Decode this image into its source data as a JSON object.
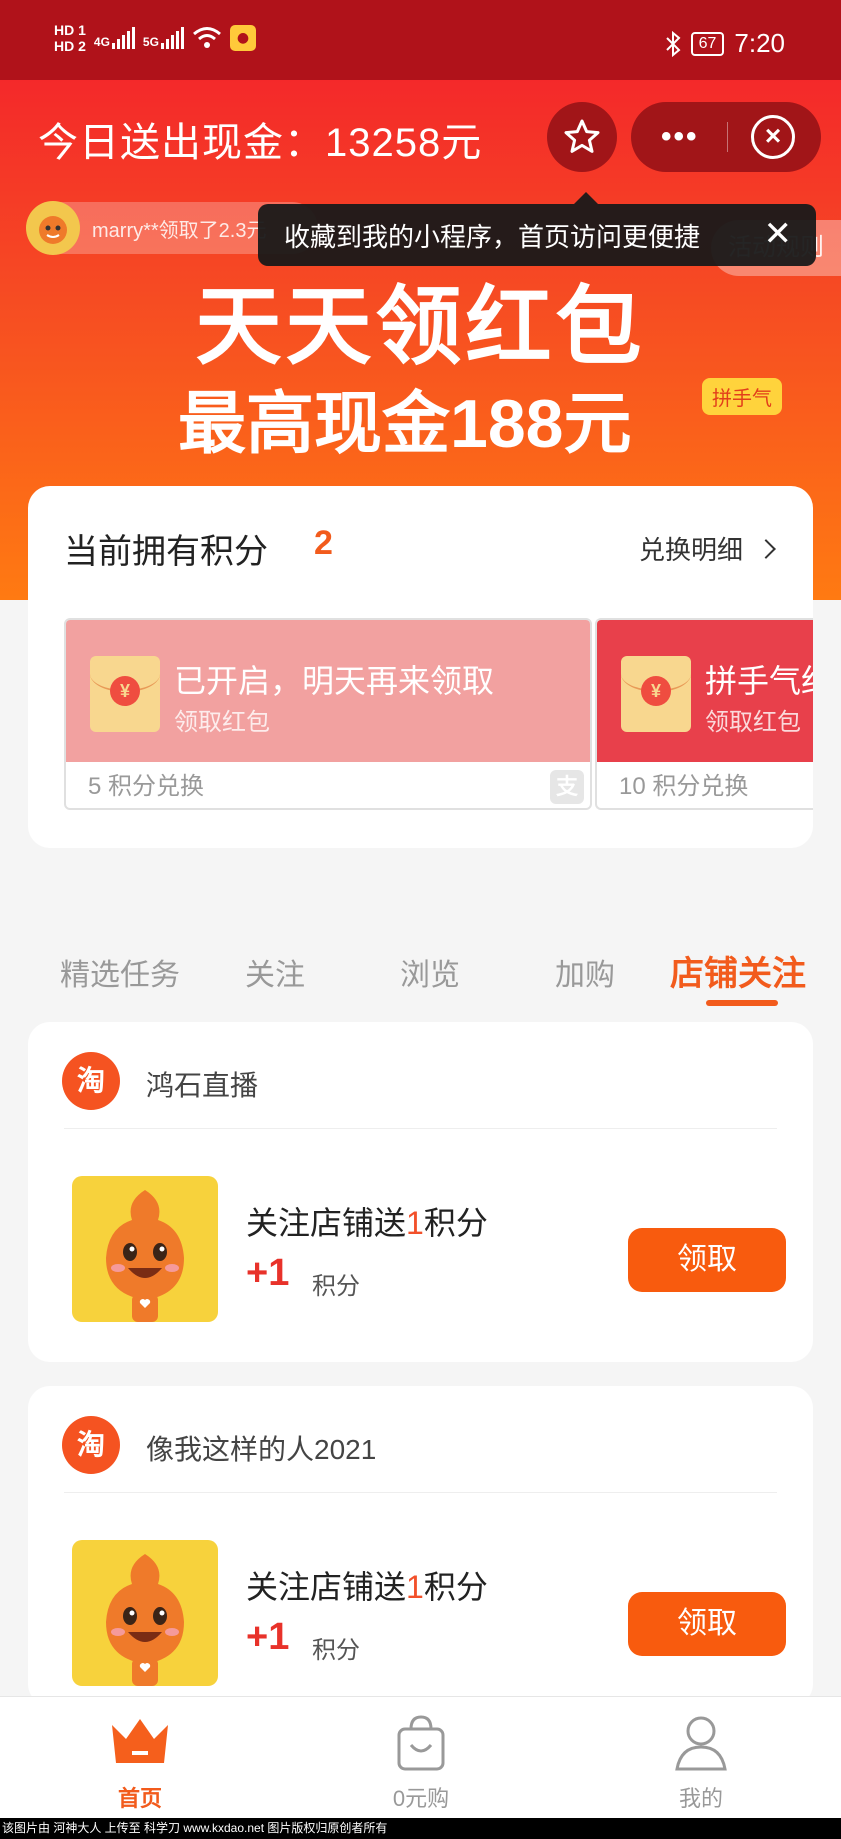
{
  "status_bar": {
    "hd1": "HD 1",
    "hd2": "HD 2",
    "net1": "4G",
    "net2": "5G",
    "battery": "67",
    "time": "7:20"
  },
  "header": {
    "cash_title": "今日送出现金：13258元"
  },
  "ticker": {
    "text": "marry**领取了2.3元"
  },
  "rules_label": "活动规则",
  "tooltip": {
    "text": "收藏到我的小程序，首页访问更便捷"
  },
  "hero": {
    "headline": "天天领红包",
    "subheadline": "最高现金188元",
    "tag": "拼手气"
  },
  "points": {
    "title": "当前拥有积分",
    "count": "2",
    "detail_link": "兑换明细",
    "packets": [
      {
        "title": "已开启，明天再来领取",
        "subtitle": "领取红包",
        "cost": "5 积分兑换"
      },
      {
        "title": "拼手气红包",
        "subtitle": "领取红包",
        "cost": "10 积分兑换"
      }
    ]
  },
  "tabs": [
    {
      "label": "精选任务"
    },
    {
      "label": "关注"
    },
    {
      "label": "浏览"
    },
    {
      "label": "加购"
    },
    {
      "label": "店铺关注"
    }
  ],
  "tasks": [
    {
      "shop_icon": "淘",
      "shop": "鸿石直播",
      "title_prefix": "关注店铺送",
      "title_num": "1",
      "title_suffix": "积分",
      "reward": "+1",
      "unit": "积分",
      "button": "领取"
    },
    {
      "shop_icon": "淘",
      "shop": "像我这样的人2021",
      "title_prefix": "关注店铺送",
      "title_num": "1",
      "title_suffix": "积分",
      "reward": "+1",
      "unit": "积分",
      "button": "领取"
    }
  ],
  "nav": [
    {
      "label": "首页",
      "icon": "crown-icon"
    },
    {
      "label": "0元购",
      "icon": "shopping-bag-icon"
    },
    {
      "label": "我的",
      "icon": "user-icon"
    }
  ],
  "watermark": "该图片由 河神大人 上传至 科学刀 www.kxdao.net 图片版权归原创者所有",
  "colors": {
    "accent": "#f25b1c",
    "status_bar": "#b0121a",
    "button": "#f85b0e"
  }
}
